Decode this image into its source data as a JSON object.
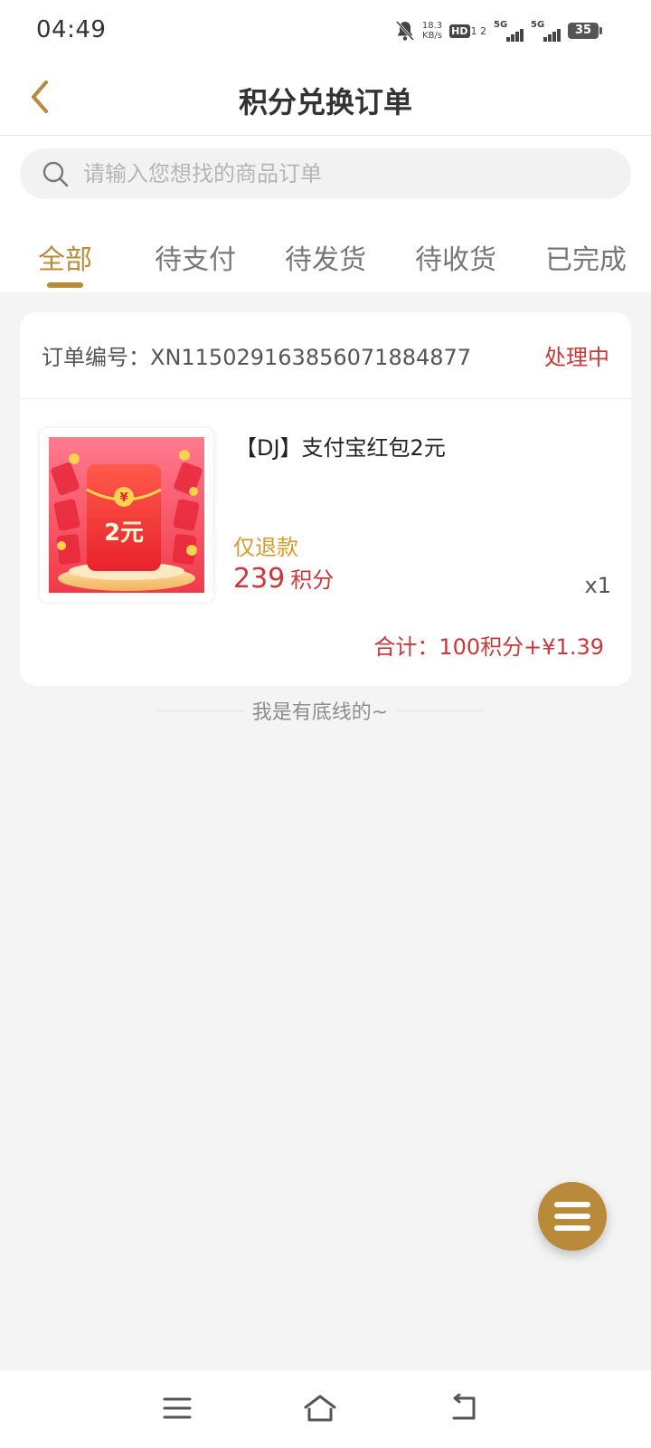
{
  "status_bar": {
    "time": "04:49",
    "net_speed_value": "18.3",
    "net_speed_unit": "KB/s",
    "hd_label": "HD",
    "hd_sims": "1 2",
    "signal_1": "5G",
    "signal_2": "5G",
    "battery": "35",
    "icons": [
      "bell-off-icon",
      "hd-icon",
      "signal-icon",
      "signal-icon",
      "battery-icon"
    ]
  },
  "header": {
    "title": "积分兑换订单",
    "back_icon": "chevron-left-icon"
  },
  "search": {
    "placeholder": "请输入您想找的商品订单",
    "icon": "search-icon"
  },
  "tabs": [
    {
      "label": "全部",
      "active": true
    },
    {
      "label": "待支付",
      "active": false
    },
    {
      "label": "待发货",
      "active": false
    },
    {
      "label": "待收货",
      "active": false
    },
    {
      "label": "已完成",
      "active": false
    }
  ],
  "order": {
    "number_label": "订单编号：",
    "number": "XN115029163856071884877",
    "status": "处理中",
    "product": {
      "name": "【DJ】支付宝红包2元",
      "thumb_text": "2元",
      "thumb_coin": "¥",
      "refund_tag": "仅退款",
      "price": "239",
      "price_unit": "积分",
      "quantity": "x1"
    },
    "total": "合计：100积分+¥1.39"
  },
  "footer_note": "我是有底线的~",
  "fab": {
    "icon": "menu-icon"
  },
  "nav": {
    "icons": [
      "menu-icon",
      "home-icon",
      "back-icon"
    ]
  },
  "colors": {
    "accent": "#b88a3a",
    "price_red": "#c9393a",
    "refund_orange": "#d79b2b",
    "background": "#f4f4f4"
  }
}
